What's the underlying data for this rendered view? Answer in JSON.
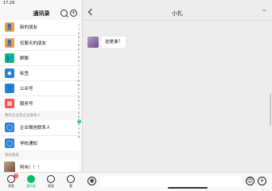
{
  "status_bar": {
    "time": "17:26"
  },
  "contacts": {
    "title": "通讯录",
    "items": [
      {
        "label": "新的朋友",
        "color": "#fa9d3b",
        "icon": "add-friend-icon",
        "glyph": "👤"
      },
      {
        "label": "仅聊天的朋友",
        "color": "#fa9d3b",
        "icon": "chat-only-friend-icon",
        "glyph": "👤"
      },
      {
        "label": "群聊",
        "color": "#07c160",
        "icon": "group-chat-icon",
        "glyph": "👥"
      },
      {
        "label": "标签",
        "color": "#2782d7",
        "icon": "tag-icon",
        "glyph": "◆"
      },
      {
        "label": "公众号",
        "color": "#2782d7",
        "icon": "official-account-icon",
        "glyph": "👤"
      },
      {
        "label": "服务号",
        "color": "#fa5151",
        "icon": "service-account-icon",
        "glyph": "▦"
      }
    ],
    "section_work": "我的企业及企业联系人",
    "work_items": [
      {
        "label": "企业微信联系人",
        "color": "#2782d7",
        "icon": "wecom-contacts-icon",
        "glyph": "◯"
      },
      {
        "label": "学校通知",
        "color": "#2782d7",
        "icon": "school-notice-icon",
        "glyph": "◯"
      }
    ],
    "section_starred": "星标朋友",
    "starred": [
      {
        "name": "阿伟！！！"
      }
    ],
    "alphabet": [
      "↑",
      "☆",
      "A",
      "B",
      "C",
      "D",
      "E",
      "F",
      "G",
      "H",
      "I",
      "J",
      "K",
      "L",
      "M",
      "N",
      "O",
      "P",
      "Q",
      "R",
      "S",
      "T",
      "U",
      "V",
      "W",
      "X",
      "Y",
      "Z",
      "#"
    ]
  },
  "tabbar": {
    "tabs": [
      {
        "label": "消息",
        "icon": "message-icon",
        "badge": "1",
        "active": false
      },
      {
        "label": "通讯录",
        "icon": "contacts-icon",
        "badge": "",
        "active": true
      },
      {
        "label": "发现",
        "icon": "discover-icon",
        "badge": "",
        "active": false
      },
      {
        "label": "我",
        "icon": "me-icon",
        "badge": "",
        "active": false
      }
    ]
  },
  "chat": {
    "title": "小扎",
    "messages": [
      {
        "text": "这是谁？",
        "from": "other"
      }
    ]
  },
  "accent_color": "#07c160"
}
